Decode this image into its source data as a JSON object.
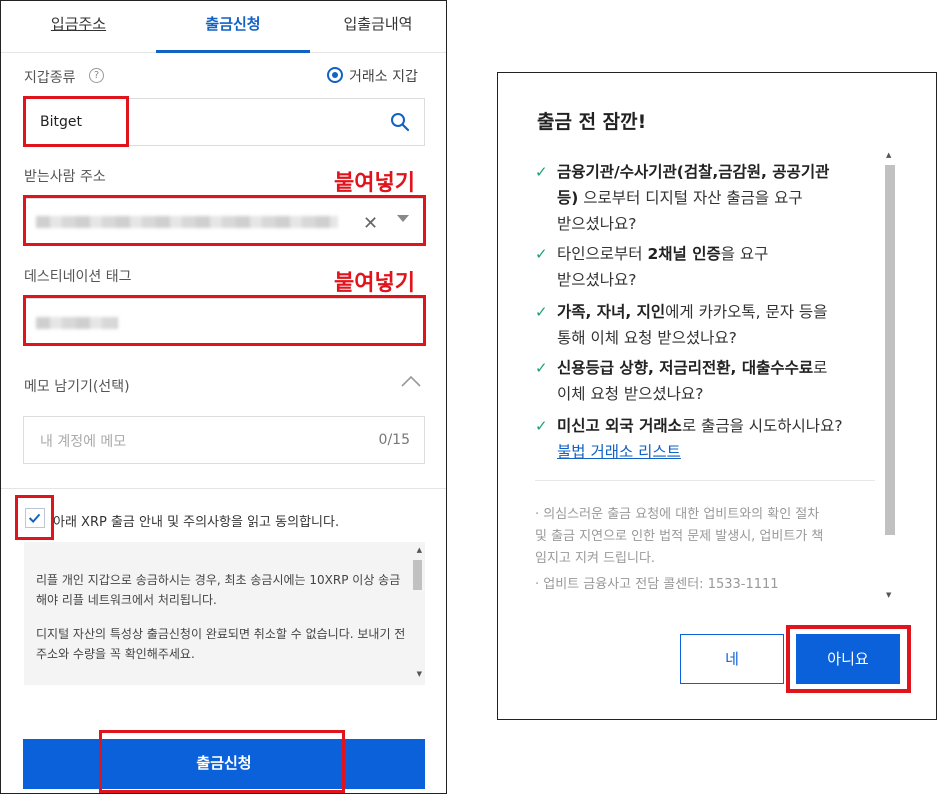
{
  "left": {
    "tabs": [
      {
        "label": "입금주소"
      },
      {
        "label": "출금신청"
      },
      {
        "label": "입출금내역"
      }
    ],
    "wallet_type_label": "지갑종류",
    "help_symbol": "?",
    "radio_label": "거래소 지갑",
    "exchange_field_value": "Bitget",
    "recipient_label": "받는사람 주소",
    "paste_annotation_1": "붙여넣기",
    "clear_symbol": "✕",
    "destination_tag_label": "데스티네이션 태그",
    "paste_annotation_2": "붙여넣기",
    "memo_label": "메모 남기기(선택)",
    "memo_placeholder": "내 계정에 메모",
    "memo_count": "0/15",
    "agree_text": "아래 XRP 출금 안내 및 주의사항을 읽고 동의합니다.",
    "notice": [
      "리플 개인 지갑으로 송금하시는 경우, 최초 송금시에는 10XRP 이상 송금해야 리플 네트워크에서 처리됩니다.",
      "디지털 자산의 특성상 출금신청이 완료되면 취소할 수 없습니다. 보내기 전 주소와 수량을 꼭 확인해주세요."
    ],
    "submit_label": "출금신청"
  },
  "modal": {
    "title": "출금 전 잠깐!",
    "check_symbol": "✓",
    "items": [
      {
        "line1_bold": "금융기관/수사기관(검찰,금감원, 공공기관",
        "line2_bold": "등)",
        "line2_rest": " 으로부터 디지털 자산 출금을 요구",
        "line3": "받으셨나요?"
      },
      {
        "line1_pre": "타인으로부터 ",
        "line1_bold": "2채널 인증",
        "line1_post": "을 요구",
        "line2": "받으셨나요?"
      },
      {
        "line1_bold": "가족, 자녀, 지인",
        "line1_post": "에게 카카오톡, 문자 등을",
        "line2": "통해 이체 요청 받으셨나요?"
      },
      {
        "line1_bold1": "신용등급 상향, 저금리전환, 대출수수료",
        "line1_post": "로",
        "line2": "이체 요청 받으셨나요?"
      },
      {
        "line1_bold": "미신고 외국 거래소",
        "line1_post": "로 출금을 시도하시나요?",
        "link": "불법 거래소 리스트"
      }
    ],
    "notes": [
      "· 의심스러운 출금 요청에 대한 업비트와의 확인 절차",
      "  및 출금 지연으로 인한 법적 문제 발생시, 업비트가 책",
      "  임지고 지켜 드립니다.",
      "· 업비트 금융사고 전담 콜센터: 1533-1111"
    ],
    "yes_label": "네",
    "no_label": "아니요"
  },
  "colors": {
    "accent": "#0b61d9",
    "annotation_red": "#e0141c",
    "check_green": "#1e9e74"
  }
}
